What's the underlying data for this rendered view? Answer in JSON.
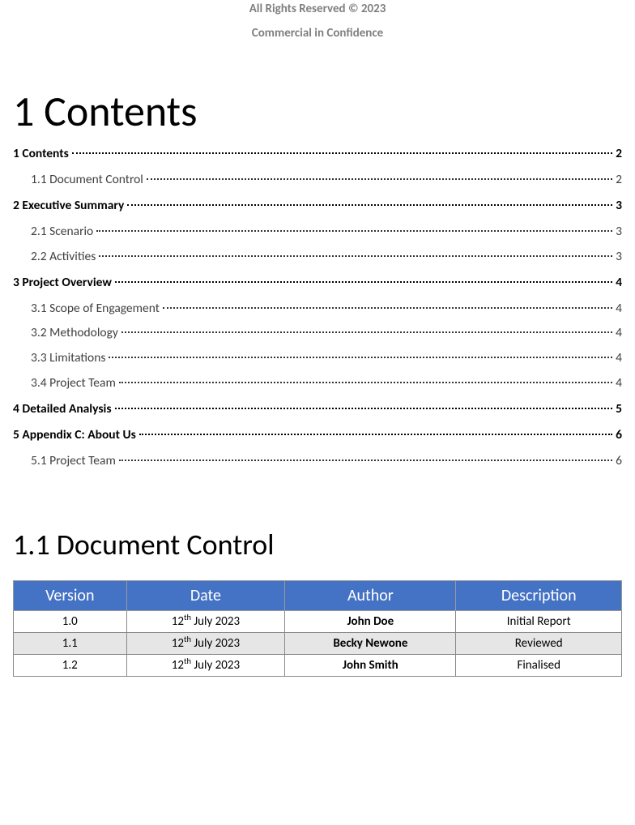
{
  "header": {
    "line1": "All Rights Reserved © 2023",
    "line2": "Commercial in Confidence"
  },
  "title": "1 Contents",
  "toc": [
    {
      "level": 1,
      "label": "1 Contents",
      "page": "2"
    },
    {
      "level": 2,
      "label": "1.1 Document Control",
      "page": "2"
    },
    {
      "level": 1,
      "label": "2 Executive Summary",
      "page": "3"
    },
    {
      "level": 2,
      "label": "2.1 Scenario",
      "page": "3"
    },
    {
      "level": 2,
      "label": "2.2 Activities",
      "page": "3"
    },
    {
      "level": 1,
      "label": "3 Project Overview",
      "page": "4"
    },
    {
      "level": 2,
      "label": "3.1 Scope of Engagement",
      "page": "4"
    },
    {
      "level": 2,
      "label": "3.2 Methodology",
      "page": "4"
    },
    {
      "level": 2,
      "label": "3.3 Limitations",
      "page": "4"
    },
    {
      "level": 2,
      "label": "3.4 Project Team",
      "page": "4"
    },
    {
      "level": 1,
      "label": "4 Detailed Analysis",
      "page": "5"
    },
    {
      "level": 1,
      "label": "5 Appendix C: About Us",
      "page": "6"
    },
    {
      "level": 2,
      "label": "5.1 Project Team",
      "page": "6"
    }
  ],
  "section_heading": "1.1 Document Control",
  "table": {
    "headers": {
      "version": "Version",
      "date": "Date",
      "author": "Author",
      "description": "Description"
    },
    "rows": [
      {
        "version": "1.0",
        "date_prefix": "12",
        "date_sup": "th",
        "date_suffix": " July 2023",
        "author": "John Doe",
        "description": "Initial Report",
        "alt": false
      },
      {
        "version": "1.1",
        "date_prefix": "12",
        "date_sup": "th",
        "date_suffix": " July 2023",
        "author": "Becky Newone",
        "description": "Reviewed",
        "alt": true
      },
      {
        "version": "1.2",
        "date_prefix": "12",
        "date_sup": "th",
        "date_suffix": " July 2023",
        "author": "John Smith",
        "description": "Finalised",
        "alt": false
      }
    ]
  }
}
